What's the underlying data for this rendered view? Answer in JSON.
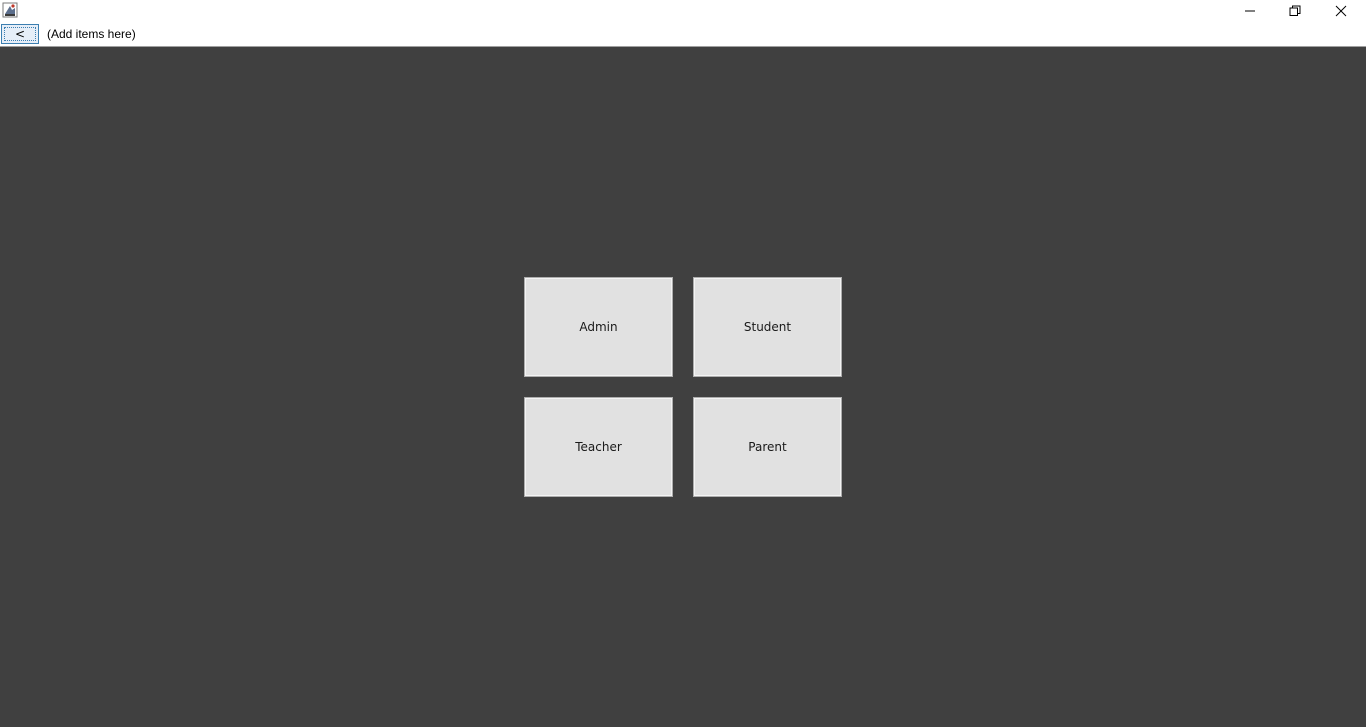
{
  "window": {
    "app_icon": "java-coffee-cup-icon",
    "controls": {
      "minimize_icon": "minimize-icon",
      "maximize_icon": "restore-icon",
      "close_icon": "close-icon"
    }
  },
  "menubar": {
    "back_label": "<",
    "placeholder_text": "(Add items here)"
  },
  "roles": {
    "admin": "Admin",
    "student": "Student",
    "teacher": "Teacher",
    "parent": "Parent"
  },
  "colors": {
    "content_background": "#404040",
    "button_background": "#e1e1e1",
    "back_button_border": "#3c7fb1"
  }
}
